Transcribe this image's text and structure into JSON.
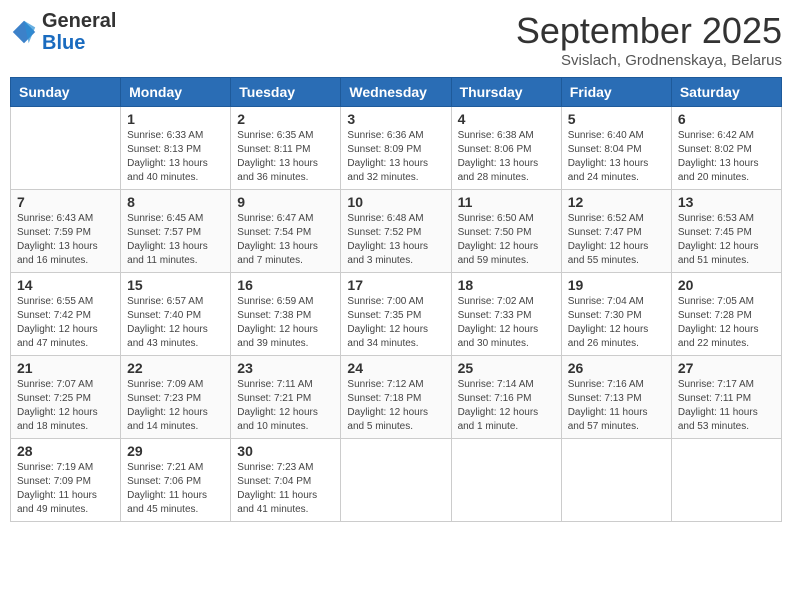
{
  "header": {
    "logo_general": "General",
    "logo_blue": "Blue",
    "month_title": "September 2025",
    "subtitle": "Svislach, Grodnenskaya, Belarus"
  },
  "days_of_week": [
    "Sunday",
    "Monday",
    "Tuesday",
    "Wednesday",
    "Thursday",
    "Friday",
    "Saturday"
  ],
  "weeks": [
    [
      {
        "day": "",
        "sunrise": "",
        "sunset": "",
        "daylight": ""
      },
      {
        "day": "1",
        "sunrise": "Sunrise: 6:33 AM",
        "sunset": "Sunset: 8:13 PM",
        "daylight": "Daylight: 13 hours and 40 minutes."
      },
      {
        "day": "2",
        "sunrise": "Sunrise: 6:35 AM",
        "sunset": "Sunset: 8:11 PM",
        "daylight": "Daylight: 13 hours and 36 minutes."
      },
      {
        "day": "3",
        "sunrise": "Sunrise: 6:36 AM",
        "sunset": "Sunset: 8:09 PM",
        "daylight": "Daylight: 13 hours and 32 minutes."
      },
      {
        "day": "4",
        "sunrise": "Sunrise: 6:38 AM",
        "sunset": "Sunset: 8:06 PM",
        "daylight": "Daylight: 13 hours and 28 minutes."
      },
      {
        "day": "5",
        "sunrise": "Sunrise: 6:40 AM",
        "sunset": "Sunset: 8:04 PM",
        "daylight": "Daylight: 13 hours and 24 minutes."
      },
      {
        "day": "6",
        "sunrise": "Sunrise: 6:42 AM",
        "sunset": "Sunset: 8:02 PM",
        "daylight": "Daylight: 13 hours and 20 minutes."
      }
    ],
    [
      {
        "day": "7",
        "sunrise": "Sunrise: 6:43 AM",
        "sunset": "Sunset: 7:59 PM",
        "daylight": "Daylight: 13 hours and 16 minutes."
      },
      {
        "day": "8",
        "sunrise": "Sunrise: 6:45 AM",
        "sunset": "Sunset: 7:57 PM",
        "daylight": "Daylight: 13 hours and 11 minutes."
      },
      {
        "day": "9",
        "sunrise": "Sunrise: 6:47 AM",
        "sunset": "Sunset: 7:54 PM",
        "daylight": "Daylight: 13 hours and 7 minutes."
      },
      {
        "day": "10",
        "sunrise": "Sunrise: 6:48 AM",
        "sunset": "Sunset: 7:52 PM",
        "daylight": "Daylight: 13 hours and 3 minutes."
      },
      {
        "day": "11",
        "sunrise": "Sunrise: 6:50 AM",
        "sunset": "Sunset: 7:50 PM",
        "daylight": "Daylight: 12 hours and 59 minutes."
      },
      {
        "day": "12",
        "sunrise": "Sunrise: 6:52 AM",
        "sunset": "Sunset: 7:47 PM",
        "daylight": "Daylight: 12 hours and 55 minutes."
      },
      {
        "day": "13",
        "sunrise": "Sunrise: 6:53 AM",
        "sunset": "Sunset: 7:45 PM",
        "daylight": "Daylight: 12 hours and 51 minutes."
      }
    ],
    [
      {
        "day": "14",
        "sunrise": "Sunrise: 6:55 AM",
        "sunset": "Sunset: 7:42 PM",
        "daylight": "Daylight: 12 hours and 47 minutes."
      },
      {
        "day": "15",
        "sunrise": "Sunrise: 6:57 AM",
        "sunset": "Sunset: 7:40 PM",
        "daylight": "Daylight: 12 hours and 43 minutes."
      },
      {
        "day": "16",
        "sunrise": "Sunrise: 6:59 AM",
        "sunset": "Sunset: 7:38 PM",
        "daylight": "Daylight: 12 hours and 39 minutes."
      },
      {
        "day": "17",
        "sunrise": "Sunrise: 7:00 AM",
        "sunset": "Sunset: 7:35 PM",
        "daylight": "Daylight: 12 hours and 34 minutes."
      },
      {
        "day": "18",
        "sunrise": "Sunrise: 7:02 AM",
        "sunset": "Sunset: 7:33 PM",
        "daylight": "Daylight: 12 hours and 30 minutes."
      },
      {
        "day": "19",
        "sunrise": "Sunrise: 7:04 AM",
        "sunset": "Sunset: 7:30 PM",
        "daylight": "Daylight: 12 hours and 26 minutes."
      },
      {
        "day": "20",
        "sunrise": "Sunrise: 7:05 AM",
        "sunset": "Sunset: 7:28 PM",
        "daylight": "Daylight: 12 hours and 22 minutes."
      }
    ],
    [
      {
        "day": "21",
        "sunrise": "Sunrise: 7:07 AM",
        "sunset": "Sunset: 7:25 PM",
        "daylight": "Daylight: 12 hours and 18 minutes."
      },
      {
        "day": "22",
        "sunrise": "Sunrise: 7:09 AM",
        "sunset": "Sunset: 7:23 PM",
        "daylight": "Daylight: 12 hours and 14 minutes."
      },
      {
        "day": "23",
        "sunrise": "Sunrise: 7:11 AM",
        "sunset": "Sunset: 7:21 PM",
        "daylight": "Daylight: 12 hours and 10 minutes."
      },
      {
        "day": "24",
        "sunrise": "Sunrise: 7:12 AM",
        "sunset": "Sunset: 7:18 PM",
        "daylight": "Daylight: 12 hours and 5 minutes."
      },
      {
        "day": "25",
        "sunrise": "Sunrise: 7:14 AM",
        "sunset": "Sunset: 7:16 PM",
        "daylight": "Daylight: 12 hours and 1 minute."
      },
      {
        "day": "26",
        "sunrise": "Sunrise: 7:16 AM",
        "sunset": "Sunset: 7:13 PM",
        "daylight": "Daylight: 11 hours and 57 minutes."
      },
      {
        "day": "27",
        "sunrise": "Sunrise: 7:17 AM",
        "sunset": "Sunset: 7:11 PM",
        "daylight": "Daylight: 11 hours and 53 minutes."
      }
    ],
    [
      {
        "day": "28",
        "sunrise": "Sunrise: 7:19 AM",
        "sunset": "Sunset: 7:09 PM",
        "daylight": "Daylight: 11 hours and 49 minutes."
      },
      {
        "day": "29",
        "sunrise": "Sunrise: 7:21 AM",
        "sunset": "Sunset: 7:06 PM",
        "daylight": "Daylight: 11 hours and 45 minutes."
      },
      {
        "day": "30",
        "sunrise": "Sunrise: 7:23 AM",
        "sunset": "Sunset: 7:04 PM",
        "daylight": "Daylight: 11 hours and 41 minutes."
      },
      {
        "day": "",
        "sunrise": "",
        "sunset": "",
        "daylight": ""
      },
      {
        "day": "",
        "sunrise": "",
        "sunset": "",
        "daylight": ""
      },
      {
        "day": "",
        "sunrise": "",
        "sunset": "",
        "daylight": ""
      },
      {
        "day": "",
        "sunrise": "",
        "sunset": "",
        "daylight": ""
      }
    ]
  ]
}
